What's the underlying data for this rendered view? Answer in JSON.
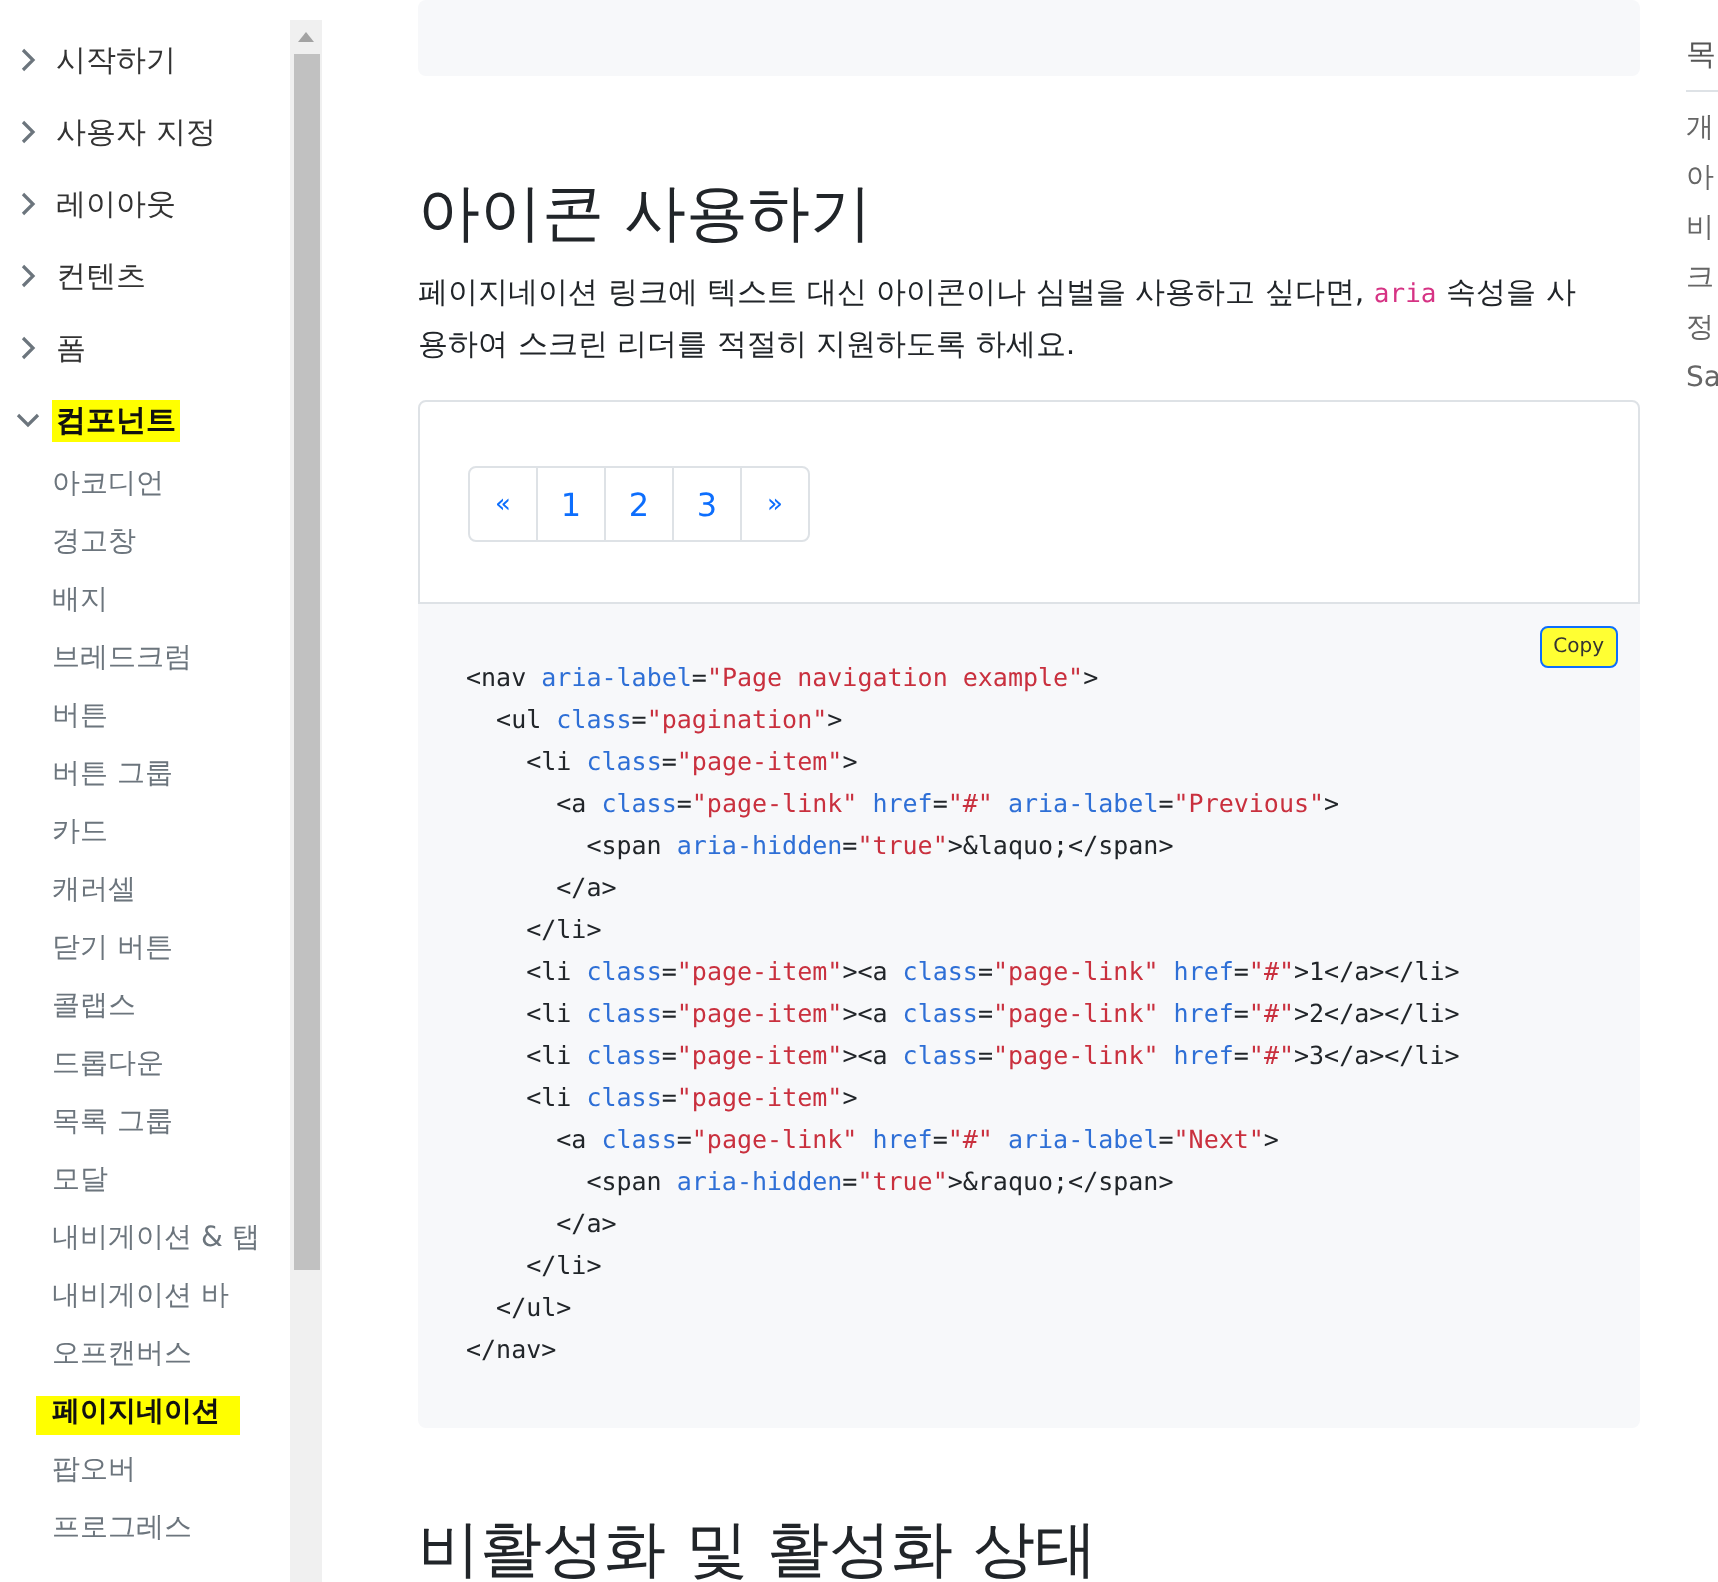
{
  "sidebar": {
    "groups": [
      {
        "label": "시작하기",
        "expanded": false,
        "highlighted": false
      },
      {
        "label": "사용자 지정",
        "expanded": false,
        "highlighted": false
      },
      {
        "label": "레이아웃",
        "expanded": false,
        "highlighted": false
      },
      {
        "label": "컨텐츠",
        "expanded": false,
        "highlighted": false
      },
      {
        "label": "폼",
        "expanded": false,
        "highlighted": false
      },
      {
        "label": "컴포넌트",
        "expanded": true,
        "highlighted": true,
        "children": [
          {
            "label": "아코디언",
            "selected": false
          },
          {
            "label": "경고창",
            "selected": false
          },
          {
            "label": "배지",
            "selected": false
          },
          {
            "label": "브레드크럼",
            "selected": false
          },
          {
            "label": "버튼",
            "selected": false
          },
          {
            "label": "버튼 그룹",
            "selected": false
          },
          {
            "label": "카드",
            "selected": false
          },
          {
            "label": "캐러셀",
            "selected": false
          },
          {
            "label": "닫기 버튼",
            "selected": false
          },
          {
            "label": "콜랩스",
            "selected": false
          },
          {
            "label": "드롭다운",
            "selected": false
          },
          {
            "label": "목록 그룹",
            "selected": false
          },
          {
            "label": "모달",
            "selected": false
          },
          {
            "label": "내비게이션 & 탭",
            "selected": false
          },
          {
            "label": "내비게이션 바",
            "selected": false
          },
          {
            "label": "오프캔버스",
            "selected": false
          },
          {
            "label": "페이지네이션",
            "selected": true
          },
          {
            "label": "팝오버",
            "selected": false
          },
          {
            "label": "프로그레스",
            "selected": false
          }
        ]
      }
    ]
  },
  "main": {
    "heading": "아이콘 사용하기",
    "paragraph": [
      {
        "kind": "text",
        "text": "페이지네이션 링크에 텍스트 대신 아이콘이나 심벌을 사용하고 싶다면, "
      },
      {
        "kind": "code",
        "text": "aria"
      },
      {
        "kind": "text",
        "text": " 속성을 사용하여 스크린 리더를 적절히 지원하도록 하세요."
      }
    ],
    "pagination": [
      {
        "label": "«"
      },
      {
        "label": "1"
      },
      {
        "label": "2"
      },
      {
        "label": "3"
      },
      {
        "label": "»"
      }
    ],
    "copy_button": {
      "label": "Copy",
      "highlighted": true
    },
    "code": [
      [
        {
          "kind": "tag",
          "text": "<nav "
        },
        {
          "kind": "attr",
          "text": "aria-label"
        },
        {
          "kind": "tag",
          "text": "="
        },
        {
          "kind": "str",
          "text": "\"Page navigation example\""
        },
        {
          "kind": "tag",
          "text": ">"
        }
      ],
      [
        {
          "kind": "tag",
          "text": "  <ul "
        },
        {
          "kind": "attr",
          "text": "class"
        },
        {
          "kind": "tag",
          "text": "="
        },
        {
          "kind": "str",
          "text": "\"pagination\""
        },
        {
          "kind": "tag",
          "text": ">"
        }
      ],
      [
        {
          "kind": "tag",
          "text": "    <li "
        },
        {
          "kind": "attr",
          "text": "class"
        },
        {
          "kind": "tag",
          "text": "="
        },
        {
          "kind": "str",
          "text": "\"page-item\""
        },
        {
          "kind": "tag",
          "text": ">"
        }
      ],
      [
        {
          "kind": "tag",
          "text": "      <a "
        },
        {
          "kind": "attr",
          "text": "class"
        },
        {
          "kind": "tag",
          "text": "="
        },
        {
          "kind": "str",
          "text": "\"page-link\" "
        },
        {
          "kind": "attr",
          "text": "href"
        },
        {
          "kind": "tag",
          "text": "="
        },
        {
          "kind": "str",
          "text": "\"#\" "
        },
        {
          "kind": "attr",
          "text": "aria-label"
        },
        {
          "kind": "tag",
          "text": "="
        },
        {
          "kind": "str",
          "text": "\"Previous\""
        },
        {
          "kind": "tag",
          "text": ">"
        }
      ],
      [
        {
          "kind": "tag",
          "text": "        <span "
        },
        {
          "kind": "attr",
          "text": "aria-hidden"
        },
        {
          "kind": "tag",
          "text": "="
        },
        {
          "kind": "str",
          "text": "\"true\""
        },
        {
          "kind": "tag",
          "text": ">&laquo;</span>"
        }
      ],
      [
        {
          "kind": "tag",
          "text": "      </a>"
        }
      ],
      [
        {
          "kind": "tag",
          "text": "    </li>"
        }
      ],
      [
        {
          "kind": "tag",
          "text": "    <li "
        },
        {
          "kind": "attr",
          "text": "class"
        },
        {
          "kind": "tag",
          "text": "="
        },
        {
          "kind": "str",
          "text": "\"page-item\""
        },
        {
          "kind": "tag",
          "text": "><a "
        },
        {
          "kind": "attr",
          "text": "class"
        },
        {
          "kind": "tag",
          "text": "="
        },
        {
          "kind": "str",
          "text": "\"page-link\" "
        },
        {
          "kind": "attr",
          "text": "href"
        },
        {
          "kind": "tag",
          "text": "="
        },
        {
          "kind": "str",
          "text": "\"#\""
        },
        {
          "kind": "tag",
          "text": ">1</a></li>"
        }
      ],
      [
        {
          "kind": "tag",
          "text": "    <li "
        },
        {
          "kind": "attr",
          "text": "class"
        },
        {
          "kind": "tag",
          "text": "="
        },
        {
          "kind": "str",
          "text": "\"page-item\""
        },
        {
          "kind": "tag",
          "text": "><a "
        },
        {
          "kind": "attr",
          "text": "class"
        },
        {
          "kind": "tag",
          "text": "="
        },
        {
          "kind": "str",
          "text": "\"page-link\" "
        },
        {
          "kind": "attr",
          "text": "href"
        },
        {
          "kind": "tag",
          "text": "="
        },
        {
          "kind": "str",
          "text": "\"#\""
        },
        {
          "kind": "tag",
          "text": ">2</a></li>"
        }
      ],
      [
        {
          "kind": "tag",
          "text": "    <li "
        },
        {
          "kind": "attr",
          "text": "class"
        },
        {
          "kind": "tag",
          "text": "="
        },
        {
          "kind": "str",
          "text": "\"page-item\""
        },
        {
          "kind": "tag",
          "text": "><a "
        },
        {
          "kind": "attr",
          "text": "class"
        },
        {
          "kind": "tag",
          "text": "="
        },
        {
          "kind": "str",
          "text": "\"page-link\" "
        },
        {
          "kind": "attr",
          "text": "href"
        },
        {
          "kind": "tag",
          "text": "="
        },
        {
          "kind": "str",
          "text": "\"#\""
        },
        {
          "kind": "tag",
          "text": ">3</a></li>"
        }
      ],
      [
        {
          "kind": "tag",
          "text": "    <li "
        },
        {
          "kind": "attr",
          "text": "class"
        },
        {
          "kind": "tag",
          "text": "="
        },
        {
          "kind": "str",
          "text": "\"page-item\""
        },
        {
          "kind": "tag",
          "text": ">"
        }
      ],
      [
        {
          "kind": "tag",
          "text": "      <a "
        },
        {
          "kind": "attr",
          "text": "class"
        },
        {
          "kind": "tag",
          "text": "="
        },
        {
          "kind": "str",
          "text": "\"page-link\" "
        },
        {
          "kind": "attr",
          "text": "href"
        },
        {
          "kind": "tag",
          "text": "="
        },
        {
          "kind": "str",
          "text": "\"#\" "
        },
        {
          "kind": "attr",
          "text": "aria-label"
        },
        {
          "kind": "tag",
          "text": "="
        },
        {
          "kind": "str",
          "text": "\"Next\""
        },
        {
          "kind": "tag",
          "text": ">"
        }
      ],
      [
        {
          "kind": "tag",
          "text": "        <span "
        },
        {
          "kind": "attr",
          "text": "aria-hidden"
        },
        {
          "kind": "tag",
          "text": "="
        },
        {
          "kind": "str",
          "text": "\"true\""
        },
        {
          "kind": "tag",
          "text": ">&raquo;</span>"
        }
      ],
      [
        {
          "kind": "tag",
          "text": "      </a>"
        }
      ],
      [
        {
          "kind": "tag",
          "text": "    </li>"
        }
      ],
      [
        {
          "kind": "tag",
          "text": "  </ul>"
        }
      ],
      [
        {
          "kind": "tag",
          "text": "</nav>"
        }
      ]
    ],
    "next_heading": "비활성화 및 활성화 상태"
  },
  "toc": {
    "title": "목",
    "items": [
      "개",
      "아",
      "비",
      "크",
      "정",
      "Sa"
    ]
  }
}
